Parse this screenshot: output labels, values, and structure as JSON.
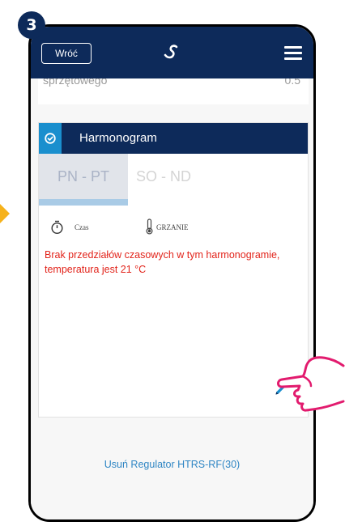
{
  "step_badge": "3",
  "header": {
    "back_label": "Wróć",
    "logo_icon": "salus-logo-icon",
    "menu_icon": "hamburger-menu-icon"
  },
  "prev_row": {
    "label": "sprzętowego",
    "value": "0.5"
  },
  "schedule": {
    "title": "Harmonogram",
    "header_icon": "schedule-icon",
    "tabs": [
      {
        "label": "PN - PT",
        "selected": true
      },
      {
        "label": "SO - ND",
        "selected": false
      }
    ],
    "time_label": "Czas",
    "heating_label": "GRZANIE",
    "empty_message": "Brak przedziałów czasowych w tym harmonogramie, temperatura jest 21 °C",
    "edit_icon": "pencil-icon"
  },
  "remove_link": "Usuń Regulator HTRS-RF(30)",
  "colors": {
    "header_bg": "#0d2a5a",
    "accent_blue": "#1a8fce",
    "message_red": "#e2231a",
    "link_blue": "#2f86c4",
    "hand_pink": "#e21b6e",
    "arrow_orange": "#f6b21b"
  }
}
